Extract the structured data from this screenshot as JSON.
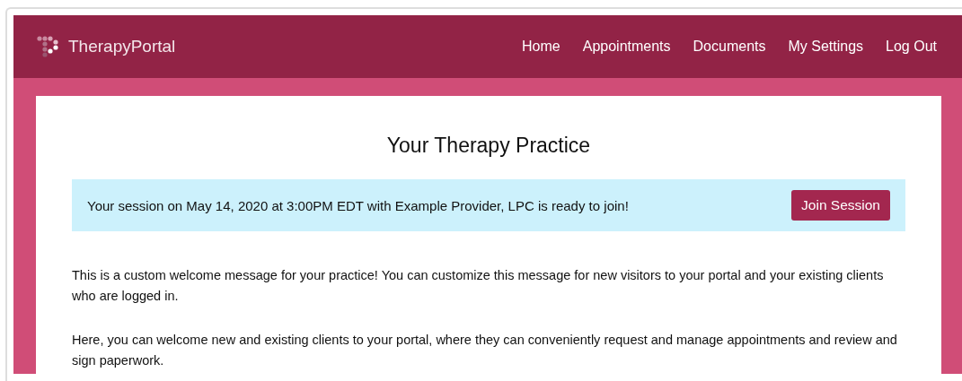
{
  "brand": "TherapyPortal",
  "nav": [
    {
      "label": "Home"
    },
    {
      "label": "Appointments"
    },
    {
      "label": "Documents"
    },
    {
      "label": "My Settings"
    },
    {
      "label": "Log Out"
    }
  ],
  "title": "Your Therapy Practice",
  "alert": {
    "message": "Your session on May 14, 2020 at 3:00PM EDT with Example Provider, LPC is ready to join!",
    "button": "Join Session"
  },
  "paragraphs": [
    "This is a custom welcome message for your practice! You can customize this message for new visitors to your portal and your existing clients who are logged in.",
    "Here, you can welcome new and existing clients to your portal, where they can conveniently request and manage appointments and review and sign paperwork."
  ]
}
